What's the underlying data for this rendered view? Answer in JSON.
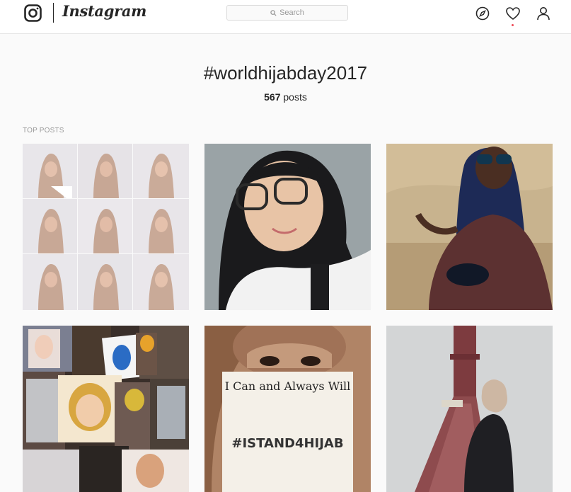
{
  "header": {
    "brand": "Instagram",
    "search_placeholder": "Search",
    "icons": [
      "instagram-logo-icon",
      "compass-icon",
      "heart-icon",
      "person-icon"
    ],
    "notification_dot_color": "#ed4956"
  },
  "tag_page": {
    "hashtag": "#worldhijabday2017",
    "post_count": "567",
    "post_count_suffix": " posts",
    "section_label": "TOP POSTS"
  },
  "posts": [
    {
      "description": "photo-grid-collage"
    },
    {
      "description": "selfie-with-glasses"
    },
    {
      "description": "woman-with-sunglasses"
    },
    {
      "description": "collage-of-portraits"
    },
    {
      "description": "sign-photo",
      "sign_line_1": "I Can and Always Will",
      "sign_line_2": "#ISTAND4HIJAB"
    },
    {
      "description": "boat-photo"
    }
  ]
}
